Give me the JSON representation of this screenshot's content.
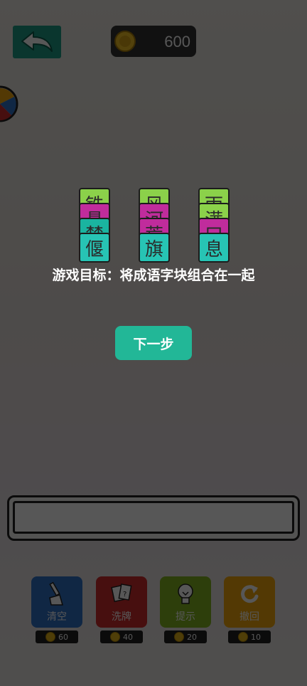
{
  "header": {
    "coins": "600"
  },
  "tiles": [
    {
      "stack": "left",
      "chars": [
        "铁",
        "悬",
        "楚",
        "偃"
      ]
    },
    {
      "stack": "middle",
      "chars": [
        "风",
        "河",
        "荒",
        "旗"
      ]
    },
    {
      "stack": "right",
      "chars": [
        "雨",
        "满",
        "口",
        "息"
      ]
    }
  ],
  "tutorial": {
    "goal": "游戏目标：将成语字块组合在一起",
    "next_label": "下一步"
  },
  "tools": [
    {
      "label": "清空",
      "cost": "60",
      "color": "#2f73c8"
    },
    {
      "label": "洗牌",
      "cost": "40",
      "color": "#cf2e2e"
    },
    {
      "label": "提示",
      "cost": "20",
      "color": "#84b521"
    },
    {
      "label": "撤回",
      "cost": "10",
      "color": "#f2a60c"
    }
  ],
  "colors": {
    "accent": "#22b797",
    "back_button": "#1f9f86",
    "tile_colors": [
      "#8bd14a",
      "#c02c9c",
      "#1ab4a0",
      "#27c4b4"
    ]
  }
}
